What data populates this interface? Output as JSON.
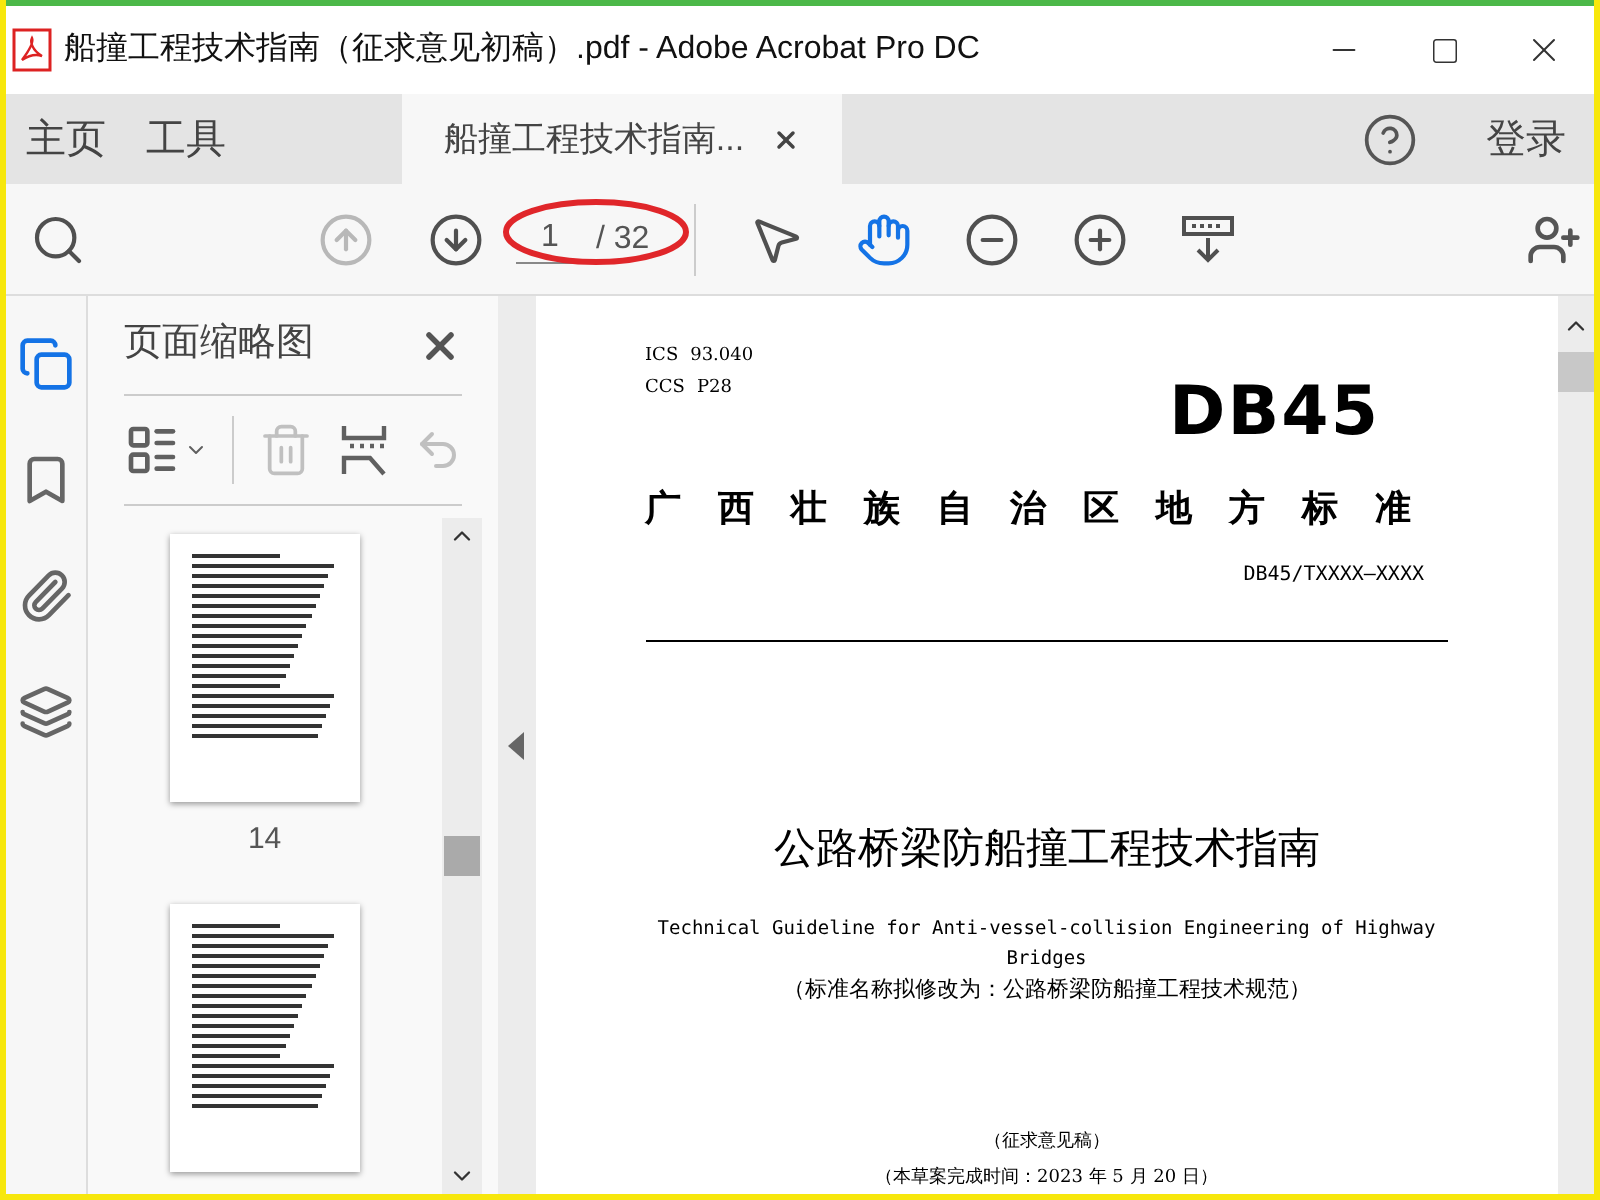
{
  "window": {
    "title": "船撞工程技术指南（征求意见初稿）.pdf - Adobe Acrobat Pro DC"
  },
  "menu_tabs": [
    {
      "label": "主页",
      "selected": false
    },
    {
      "label": "工具",
      "selected": false
    },
    {
      "label": "船撞工程技术指南...",
      "selected": true
    }
  ],
  "sign_in": "登录",
  "toolbar": {
    "tools": [
      {
        "kind": "find",
        "disabled": false,
        "selected": false
      },
      {
        "kind": "previous-page",
        "disabled": true,
        "selected": false
      },
      {
        "kind": "next-page",
        "disabled": false,
        "selected": false
      }
    ],
    "page_current": "1",
    "page_total": "/ 32",
    "view_tools": [
      {
        "kind": "select",
        "disabled": false,
        "selected": false
      },
      {
        "kind": "hand",
        "disabled": false,
        "selected": true
      },
      {
        "kind": "zoom-out",
        "disabled": false,
        "selected": false
      },
      {
        "kind": "zoom-in",
        "disabled": false,
        "selected": false
      },
      {
        "kind": "read-mode",
        "disabled": false,
        "selected": false
      }
    ]
  },
  "side_rail": [
    {
      "kind": "pages",
      "selected": true
    },
    {
      "kind": "bookmarks",
      "selected": false
    },
    {
      "kind": "attachments",
      "selected": false
    },
    {
      "kind": "layers",
      "selected": false
    }
  ],
  "thumbnails_panel": {
    "title": "页面缩略图",
    "tools": [
      {
        "kind": "options",
        "disabled": false
      },
      {
        "kind": "delete",
        "disabled": true
      },
      {
        "kind": "extract",
        "disabled": false
      },
      {
        "kind": "undo",
        "disabled": true
      }
    ],
    "thumbnails": [
      {
        "label": "14"
      }
    ]
  },
  "document": {
    "ics_label": "ICS",
    "ics_value": "93.040",
    "ccs_label": "CCS",
    "ccs_value": "P28",
    "code": "DB45",
    "standard_type": "广西壮族自治区地方标准",
    "number": "DB45/TXXXX—XXXX",
    "title": "公路桥梁防船撞工程技术指南",
    "english_title": "Technical Guideline for Anti-vessel-collision Engineering of Highway Bridges",
    "note": "（标准名称拟修改为：公路桥梁防船撞工程技术规范）",
    "draft": "（征求意见稿）",
    "completed": "（本草案完成时间：2023 年 5 月 20 日）"
  }
}
